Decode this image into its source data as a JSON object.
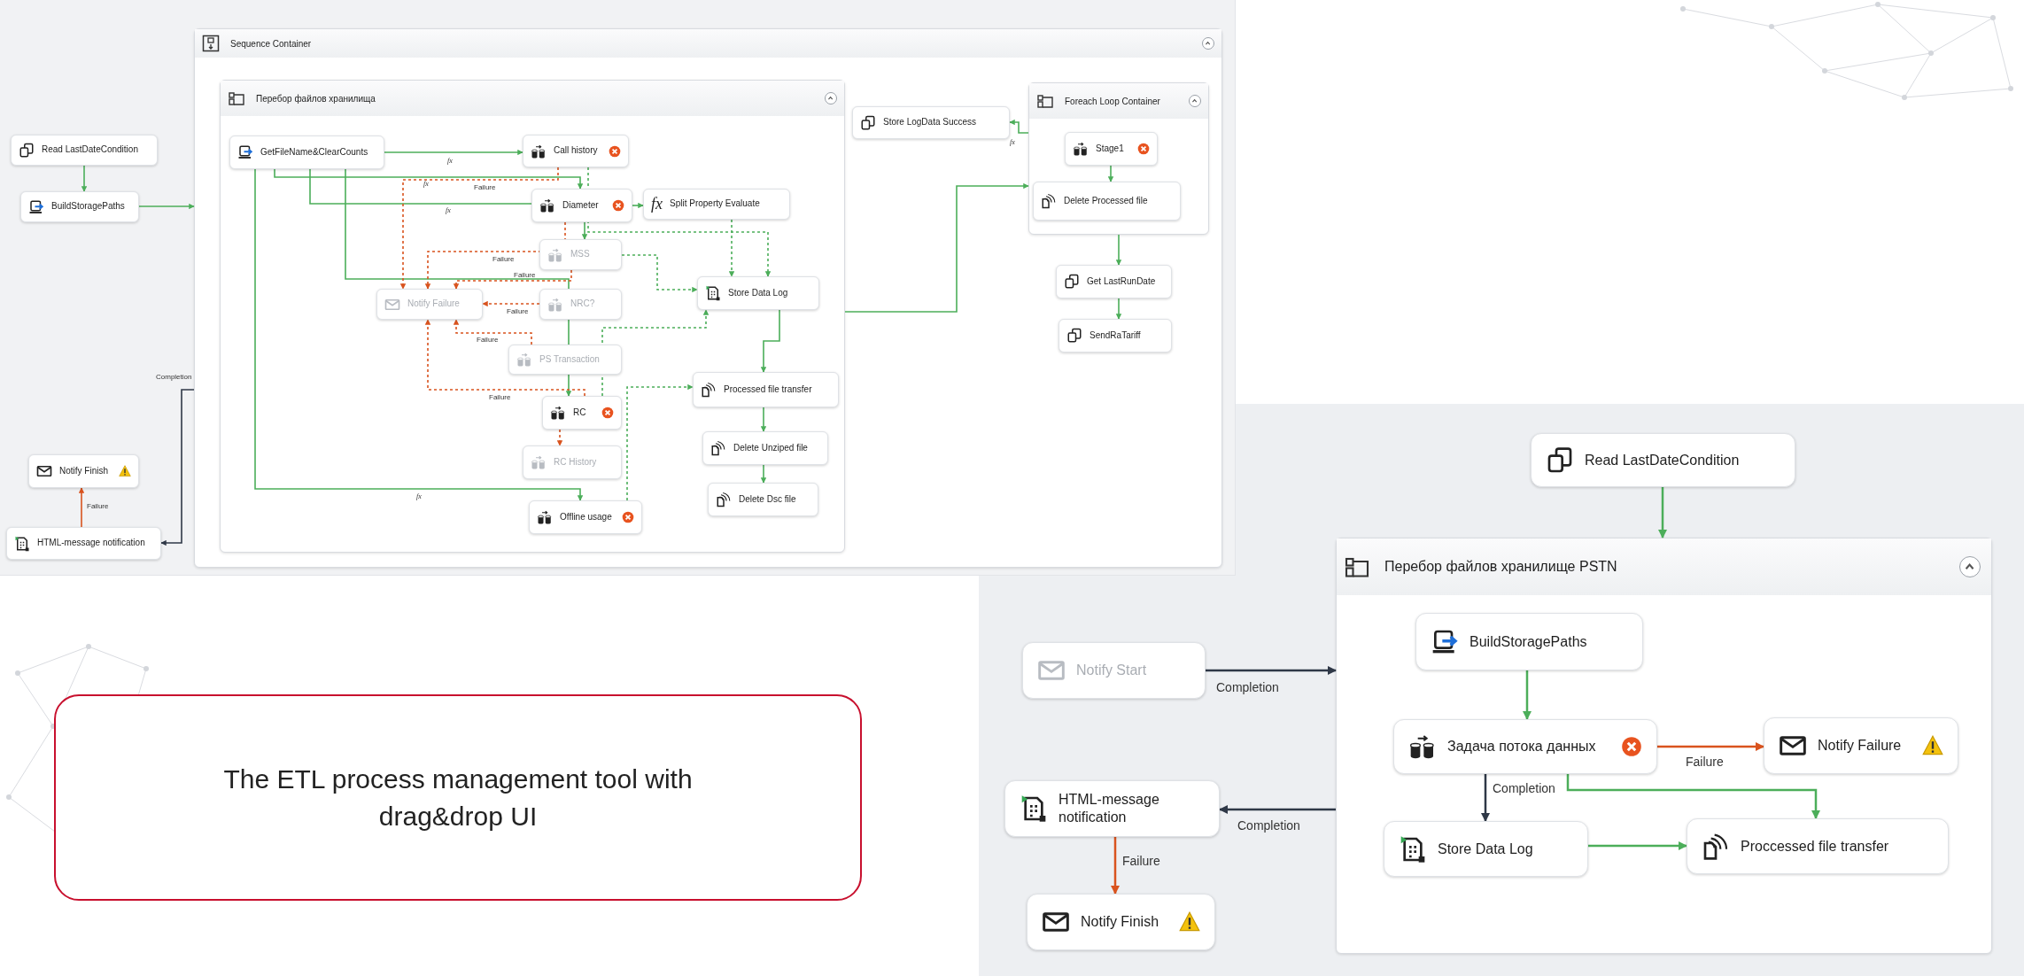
{
  "top_diagram": {
    "containers": [
      {
        "title": "Sequence Container",
        "kind": "sequence",
        "expanded": true
      },
      {
        "title": "Перебор файлов хранилища",
        "kind": "loop",
        "expanded": true
      },
      {
        "title": "Foreach Loop Container",
        "kind": "loop",
        "expanded": true
      }
    ],
    "nodes": [
      {
        "label": "Read LastDateCondition",
        "kind": "sql",
        "error": false,
        "warning": false,
        "disabled": false
      },
      {
        "label": "BuildStoragePaths",
        "kind": "script",
        "error": false,
        "warning": false,
        "disabled": false
      },
      {
        "label": "Notify Finish",
        "kind": "mail",
        "error": false,
        "warning": true,
        "disabled": false
      },
      {
        "label": "HTML-message notification",
        "kind": "log",
        "error": false,
        "warning": false,
        "disabled": false
      },
      {
        "label": "GetFileName&ClearCounts",
        "kind": "script",
        "error": false,
        "warning": false,
        "disabled": false
      },
      {
        "label": "Call history",
        "kind": "dataflow",
        "error": true,
        "warning": false,
        "disabled": false
      },
      {
        "label": "Diameter",
        "kind": "dataflow",
        "error": true,
        "warning": false,
        "disabled": false
      },
      {
        "label": "Split Property Evaluate",
        "kind": "expression",
        "glyph": "fx",
        "error": false,
        "warning": false,
        "disabled": false
      },
      {
        "label": "MSS",
        "kind": "dataflow",
        "error": false,
        "warning": false,
        "disabled": true
      },
      {
        "label": "Notify Failure",
        "kind": "mail",
        "error": false,
        "warning": false,
        "disabled": true
      },
      {
        "label": "NRC?",
        "kind": "dataflow",
        "error": false,
        "warning": false,
        "disabled": true
      },
      {
        "label": "PS Transaction",
        "kind": "dataflow",
        "error": false,
        "warning": false,
        "disabled": true
      },
      {
        "label": "RC",
        "kind": "dataflow",
        "error": true,
        "warning": false,
        "disabled": false
      },
      {
        "label": "RC History",
        "kind": "dataflow",
        "error": false,
        "warning": false,
        "disabled": true
      },
      {
        "label": "Offline usage",
        "kind": "dataflow",
        "error": true,
        "warning": false,
        "disabled": false
      },
      {
        "label": "Store Data Log",
        "kind": "log",
        "error": false,
        "warning": false,
        "disabled": false
      },
      {
        "label": "Processed file transfer",
        "kind": "file",
        "error": false,
        "warning": false,
        "disabled": false
      },
      {
        "label": "Delete Unziped file",
        "kind": "file",
        "error": false,
        "warning": false,
        "disabled": false
      },
      {
        "label": "Delete Dsc file",
        "kind": "file",
        "error": false,
        "warning": false,
        "disabled": false
      },
      {
        "label": "Store LogData Success",
        "kind": "sql",
        "error": false,
        "warning": false,
        "disabled": false
      },
      {
        "label": "Stage1",
        "kind": "dataflow",
        "error": true,
        "warning": false,
        "disabled": false
      },
      {
        "label": "Delete Processed file",
        "kind": "file",
        "error": false,
        "warning": false,
        "disabled": false
      },
      {
        "label": "Get LastRunDate",
        "kind": "sql",
        "error": false,
        "warning": false,
        "disabled": false
      },
      {
        "label": "SendRaTariff",
        "kind": "sql",
        "error": false,
        "warning": false,
        "disabled": false
      }
    ],
    "connectors": [
      {
        "kind": "success"
      },
      {
        "kind": "success"
      },
      {
        "kind": "completion",
        "label": "Completion"
      },
      {
        "kind": "failure",
        "label": "Failure"
      },
      {
        "kind": "success",
        "label": "fx"
      },
      {
        "kind": "success",
        "label": "fx"
      },
      {
        "kind": "success",
        "label": "fx"
      },
      {
        "kind": "success"
      },
      {
        "kind": "success",
        "label": "fx"
      },
      {
        "kind": "failure-or",
        "label": "Failure"
      },
      {
        "kind": "success"
      },
      {
        "kind": "failure-or",
        "label": "Failure"
      },
      {
        "kind": "failure-or",
        "label": "Failure"
      },
      {
        "kind": "failure-or",
        "label": "Failure"
      },
      {
        "kind": "failure-or",
        "label": "Failure"
      },
      {
        "kind": "failure-or",
        "label": "Failure"
      },
      {
        "kind": "failure-or"
      },
      {
        "kind": "success-or"
      },
      {
        "kind": "success-or"
      },
      {
        "kind": "success-or"
      },
      {
        "kind": "success-or"
      },
      {
        "kind": "success-or"
      },
      {
        "kind": "success"
      },
      {
        "kind": "success"
      },
      {
        "kind": "success"
      },
      {
        "kind": "success"
      },
      {
        "kind": "success",
        "label": "fx"
      },
      {
        "kind": "success"
      },
      {
        "kind": "success"
      },
      {
        "kind": "success"
      }
    ]
  },
  "bottom_diagram": {
    "containers": [
      {
        "title": "Перебор файлов хранилище PSTN",
        "kind": "loop",
        "expanded": true
      }
    ],
    "nodes": [
      {
        "label": "Read LastDateCondition",
        "kind": "sql",
        "error": false,
        "warning": false,
        "disabled": false
      },
      {
        "label": "Notify Start",
        "kind": "mail",
        "error": false,
        "warning": false,
        "disabled": true
      },
      {
        "label": "BuildStoragePaths",
        "kind": "script",
        "error": false,
        "warning": false,
        "disabled": false
      },
      {
        "label": "Задача потока данных",
        "kind": "dataflow",
        "error": true,
        "warning": false,
        "disabled": false
      },
      {
        "label": "Notify Failure",
        "kind": "mail",
        "error": false,
        "warning": true,
        "disabled": false
      },
      {
        "label": "HTML-message notification",
        "kind": "log",
        "error": false,
        "warning": false,
        "disabled": false
      },
      {
        "label": "Store Data Log",
        "kind": "log",
        "error": false,
        "warning": false,
        "disabled": false
      },
      {
        "label": "Proccessed file transfer",
        "kind": "file",
        "error": false,
        "warning": false,
        "disabled": false
      },
      {
        "label": "Notify Finish",
        "kind": "mail",
        "error": false,
        "warning": true,
        "disabled": false
      }
    ],
    "connectors": [
      {
        "kind": "success"
      },
      {
        "kind": "completion",
        "label": "Completion"
      },
      {
        "kind": "success"
      },
      {
        "kind": "failure",
        "label": "Failure"
      },
      {
        "kind": "completion",
        "label": "Completion"
      },
      {
        "kind": "success"
      },
      {
        "kind": "success"
      },
      {
        "kind": "completion",
        "label": "Completion"
      },
      {
        "kind": "failure",
        "label": "Failure"
      }
    ]
  },
  "caption": "The ETL process management tool with drag&drop UI"
}
